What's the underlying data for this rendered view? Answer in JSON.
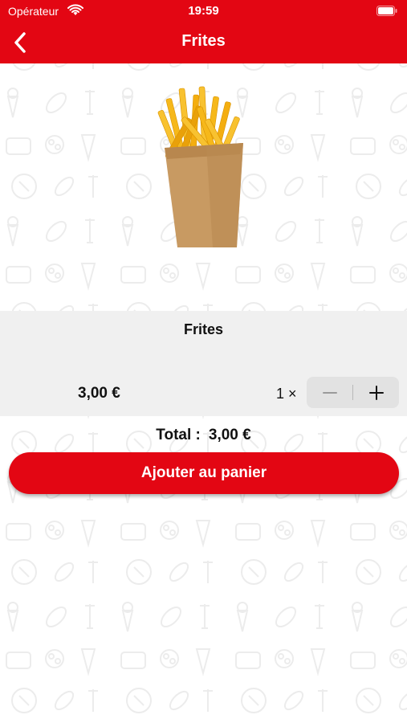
{
  "status_bar": {
    "carrier": "Opérateur",
    "time": "19:59",
    "wifi_icon": "wifi-icon",
    "battery_icon": "battery-icon"
  },
  "nav": {
    "title": "Frites",
    "back_icon": "chevron-left-icon"
  },
  "product": {
    "image": "french-fries-image",
    "name": "Frites",
    "unit_price": "3,00 €",
    "quantity_label": "1 ×",
    "quantity": 1
  },
  "stepper": {
    "minus_icon": "minus-icon",
    "plus_icon": "plus-icon"
  },
  "total": {
    "label": "Total :",
    "value": "3,00 €"
  },
  "add_button": {
    "label": "Ajouter au panier"
  },
  "colors": {
    "brand_red": "#e30613",
    "panel_gray": "#f0f0f0",
    "stepper_gray": "#e2e2e2"
  }
}
